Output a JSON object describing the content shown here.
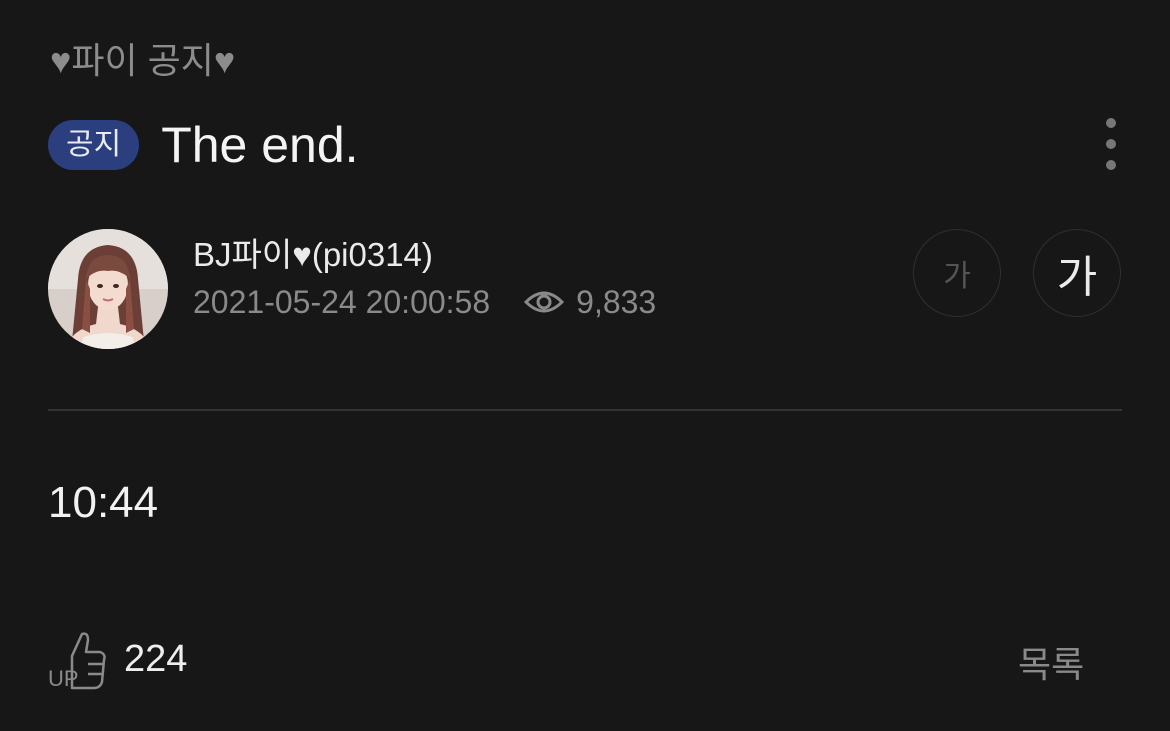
{
  "board": {
    "name": "♥파이 공지♥"
  },
  "post": {
    "badge": "공지",
    "title": "The end.",
    "author": "BJ파이♥(pi0314)",
    "datetime": "2021-05-24 20:00:58",
    "views": "9,833",
    "content": "10:44"
  },
  "font_controls": {
    "small_label": "가",
    "large_label": "가"
  },
  "footer": {
    "up_label": "UP",
    "up_count": "224",
    "list_label": "목록"
  },
  "icons": {
    "more": "more-vertical-icon",
    "views": "eye-icon",
    "up": "thumbs-up-icon"
  },
  "colors": {
    "background": "#171717",
    "badge": "#2b3f7e",
    "muted_text": "#8a8a8a"
  }
}
